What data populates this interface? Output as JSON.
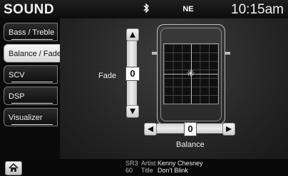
{
  "header": {
    "title": "SOUND",
    "bluetooth_icon": "bluetooth-icon",
    "compass": "NE",
    "clock": "10:15am"
  },
  "tabs": [
    {
      "label": "Bass / Treble",
      "active": false
    },
    {
      "label": "Balance / Fade",
      "active": true
    },
    {
      "label": "SCV",
      "active": false
    },
    {
      "label": "DSP",
      "active": false
    },
    {
      "label": "Visualizer",
      "active": false
    }
  ],
  "fade": {
    "label": "Fade",
    "value": "0"
  },
  "balance": {
    "label": "Balance",
    "value": "0"
  },
  "now_playing": {
    "source": "SR3",
    "channel": "60",
    "artist_key": "Artist",
    "artist": "Kenny Chesney",
    "title_key": "Title",
    "title": "Don't Blink"
  },
  "colors": {
    "active_tab": "#e9e9e9",
    "background": "#1a1a1a"
  }
}
